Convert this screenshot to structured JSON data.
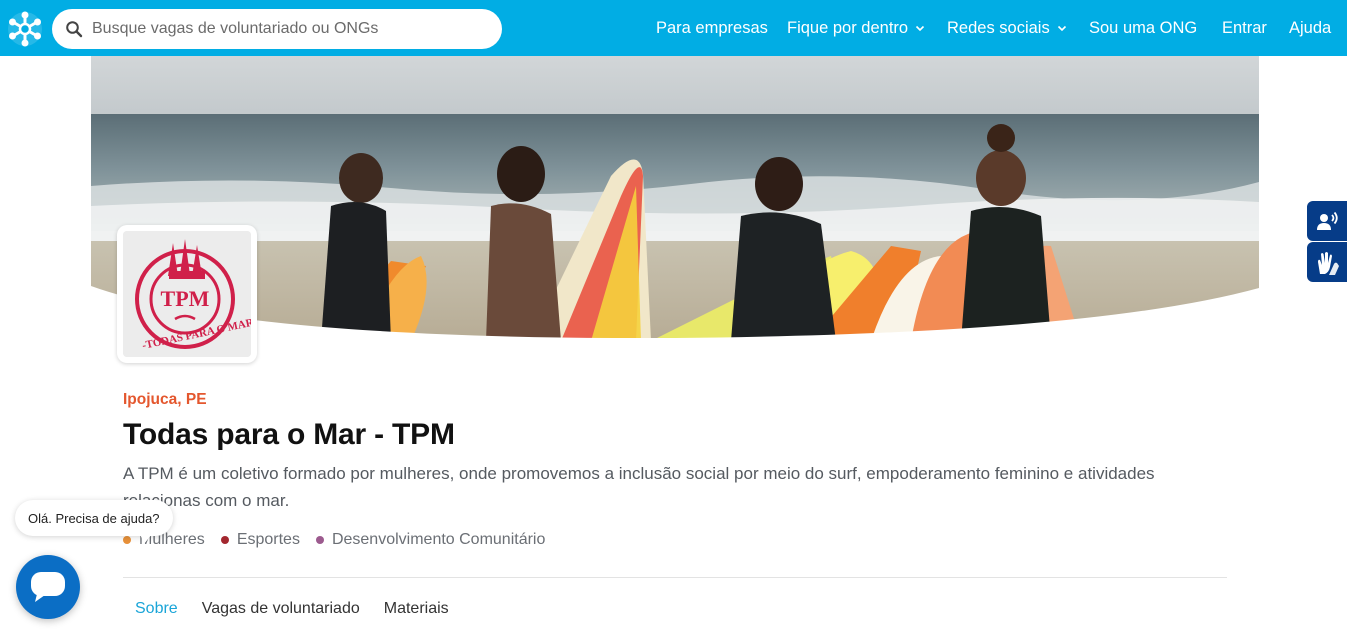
{
  "header": {
    "search": {
      "placeholder": "Busque vagas de voluntariado ou ONGs",
      "value": ""
    },
    "nav": [
      {
        "label": "Para empresas",
        "dropdown": false
      },
      {
        "label": "Fique por dentro",
        "dropdown": true
      },
      {
        "label": "Redes sociais",
        "dropdown": true
      },
      {
        "label": "Sou uma ONG",
        "dropdown": false
      },
      {
        "label": "Entrar",
        "dropdown": false
      },
      {
        "label": "Ajuda",
        "dropdown": false
      }
    ]
  },
  "org": {
    "logo_text": "TPM",
    "logo_ring_text": "-TODAS PARA O MAR-",
    "location": "Ipojuca, PE",
    "name": "Todas para o Mar - TPM",
    "description": "A TPM é um coletivo formado por mulheres, onde promovemos a inclusão social por meio do surf, empoderamento feminino e atividades relacionas com o mar.",
    "causes": [
      {
        "label": "Mulheres",
        "color": "#E8913A"
      },
      {
        "label": "Esportes",
        "color": "#A3272F"
      },
      {
        "label": "Desenvolvimento Comunitário",
        "color": "#9C5A8E"
      }
    ]
  },
  "tabs": [
    {
      "label": "Sobre",
      "active": true
    },
    {
      "label": "Vagas de voluntariado",
      "active": false
    },
    {
      "label": "Materiais",
      "active": false
    }
  ],
  "chat": {
    "greeting": "Olá. Precisa de ajuda?"
  },
  "accessibility": {
    "buttons": [
      "audio-libras-icon",
      "hands-sign-language-icon"
    ]
  },
  "colors": {
    "header": "#01ADE4",
    "location": "#E4572E",
    "tab_active": "#1aa5d8",
    "chat_button": "#0b6ec5",
    "accessibility": "#063C88"
  }
}
